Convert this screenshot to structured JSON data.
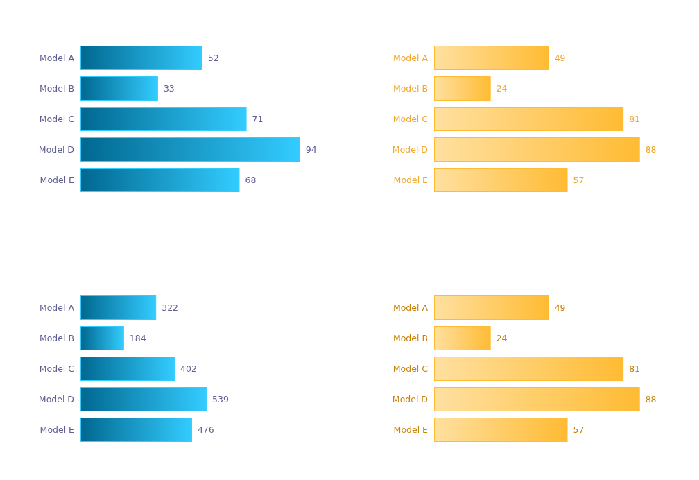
{
  "charts": [
    {
      "labels": {
        "color": "#5f5f94"
      },
      "gradient": {
        "color": "#006890"
      },
      "chart_data": {
        "type": "bar",
        "orientation": "horizontal",
        "categories": [
          "Model A",
          "Model B",
          "Model C",
          "Model D",
          "Model E"
        ],
        "data_labels": true,
        "series": [
          {
            "color": "#33ccff",
            "values": [
              52,
              33,
              71,
              94,
              68
            ]
          }
        ]
      }
    },
    {
      "labels": {
        "color": "#f0a830"
      },
      "gradient": {
        "color": "#ffe0a0"
      },
      "chart_data": {
        "type": "bar",
        "orientation": "horizontal",
        "categories": [
          "Model A",
          "Model B",
          "Model C",
          "Model D",
          "Model E"
        ],
        "data_labels": true,
        "series": [
          {
            "color": "#ffbb33",
            "values": [
              49,
              24,
              81,
              88,
              57
            ]
          }
        ]
      }
    },
    {
      "labels": {
        "color": "#5f5f94"
      },
      "gradient": {
        "color": "#006890"
      },
      "chart_data": {
        "type": "bar",
        "orientation": "horizontal",
        "categories": [
          "Model A",
          "Model B",
          "Model C",
          "Model D",
          "Model E"
        ],
        "data_labels": true,
        "series": [
          {
            "color": "#33ccff",
            "values": [
              322,
              184,
              402,
              539,
              476
            ]
          }
        ]
      }
    },
    {
      "labels": {
        "color": "#c8820a"
      },
      "gradient": {
        "color": "#ffe0a0"
      },
      "chart_data": {
        "type": "bar",
        "orientation": "horizontal",
        "categories": [
          "Model A",
          "Model B",
          "Model C",
          "Model D",
          "Model E"
        ],
        "data_labels": true,
        "series": [
          {
            "color": "#ffbb33",
            "values": [
              49,
              24,
              81,
              88,
              57
            ]
          }
        ]
      }
    }
  ]
}
